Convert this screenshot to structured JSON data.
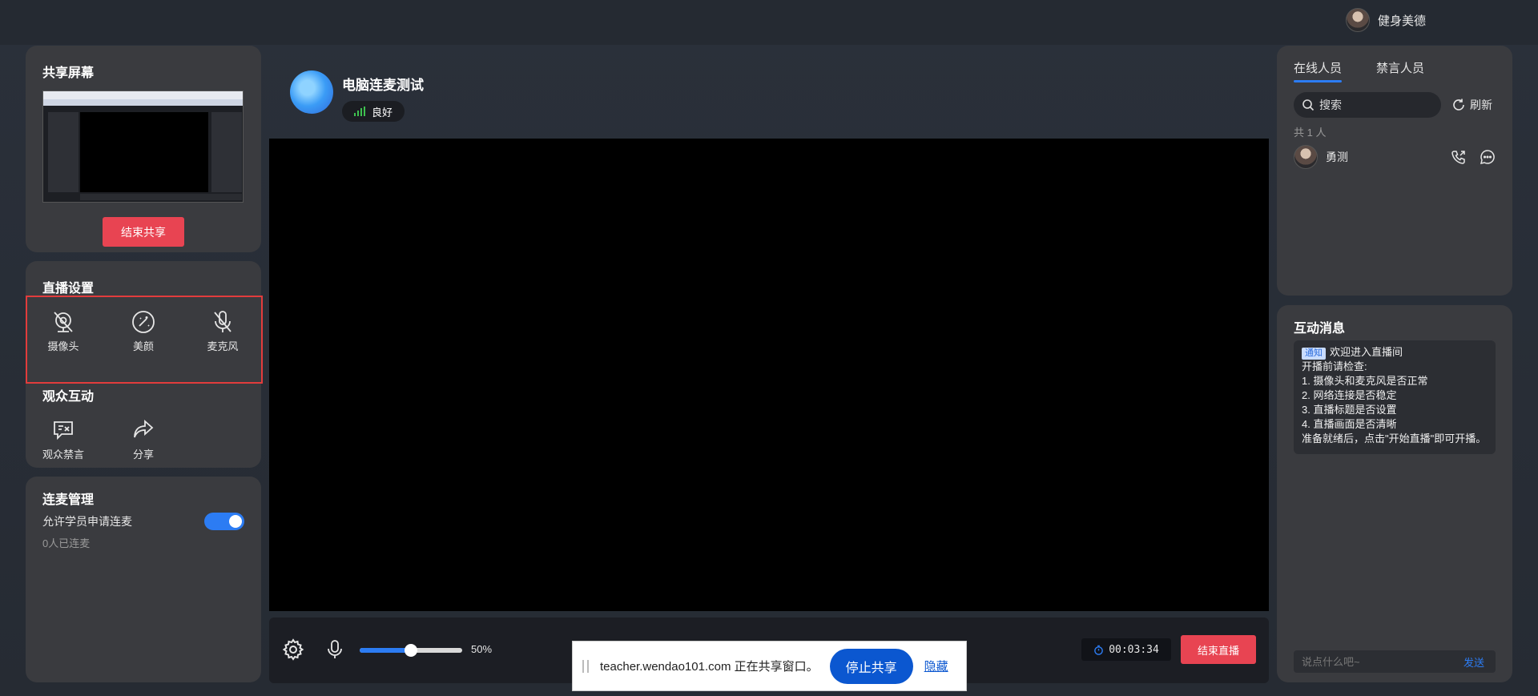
{
  "user": {
    "name": "健身美德"
  },
  "share": {
    "title": "共享屏幕",
    "end_label": "结束共享"
  },
  "settings": {
    "title": "直播设置",
    "tools": [
      {
        "label": "摄像头",
        "icon": "camera-off-icon"
      },
      {
        "label": "美颜",
        "icon": "beauty-icon"
      },
      {
        "label": "麦克风",
        "icon": "mic-off-icon"
      }
    ]
  },
  "audience": {
    "title": "观众互动",
    "tools": [
      {
        "label": "观众禁言",
        "icon": "mute-audience-icon"
      },
      {
        "label": "分享",
        "icon": "share-icon"
      }
    ]
  },
  "link": {
    "title": "连麦管理",
    "allow_label": "允许学员申请连麦",
    "allow_enabled": true,
    "linked_count": "0人已连麦"
  },
  "room": {
    "title": "电脑连麦测试",
    "network": "良好"
  },
  "controls": {
    "volume_label": "50%",
    "volume_value": 0.5,
    "timer": "00:03:34",
    "end_live_label": "结束直播"
  },
  "share_banner": {
    "text": "teacher.wendao101.com 正在共享窗口。",
    "stop_label": "停止共享",
    "hide_label": "隐藏"
  },
  "members": {
    "tabs": [
      "在线人员",
      "禁言人员"
    ],
    "search_placeholder": "搜索",
    "refresh_label": "刷新",
    "count_label": "共 1 人",
    "list": [
      {
        "name": "勇测"
      }
    ]
  },
  "chat": {
    "title": "互动消息",
    "notice_tag": "通知",
    "notice_head": "欢迎进入直播间",
    "notice_lines": [
      "开播前请检查:",
      "1. 摄像头和麦克风是否正常",
      "2. 网络连接是否稳定",
      "3. 直播标题是否设置",
      "4. 直播画面是否清晰",
      "准备就绪后，点击\"开始直播\"即可开播。"
    ],
    "input_placeholder": "说点什么吧~",
    "send_label": "发送"
  },
  "colors": {
    "accent": "#2c7cf3",
    "danger": "#e84452",
    "panel": "#3a3b3f",
    "signal": "#3ec24f"
  }
}
